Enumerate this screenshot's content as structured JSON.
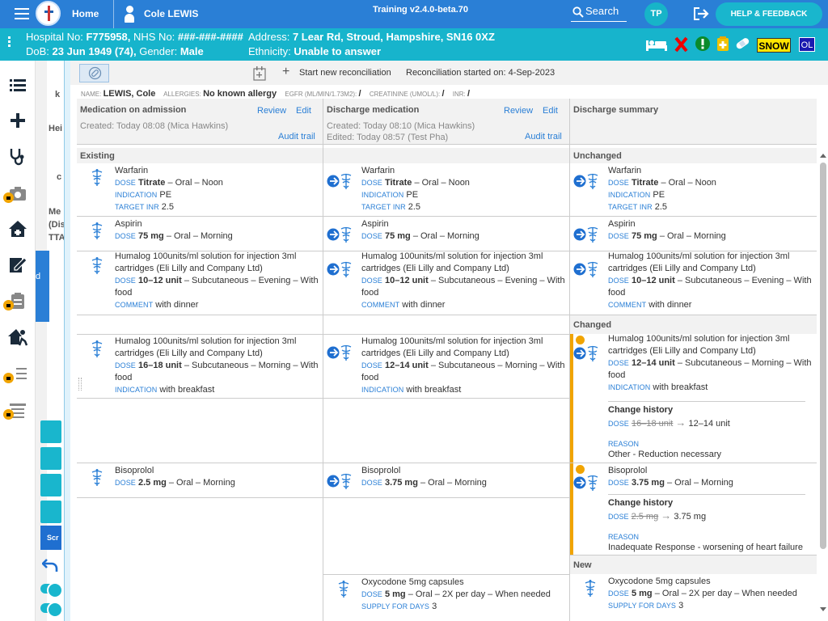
{
  "header": {
    "home_label": "Home",
    "patient_name": "Cole LEWIS",
    "training_label": "Training v2.4.0-beta.70",
    "search_label": "Search",
    "user_initials": "TP",
    "help_label": "HELP & FEEDBACK"
  },
  "patient_banner": {
    "hospital_no_label": "Hospital No:",
    "hospital_no": "F775958,",
    "nhs_label": "NHS No:",
    "nhs_no": "###-###-####",
    "address_label": "Address:",
    "address": "7 Lear Rd, Stroud, Hampshire, SN16 0XZ",
    "dob_label": "DoB:",
    "dob": "23 Jun 1949 (74),",
    "gender_label": "Gender:",
    "gender": "Male",
    "ethnicity_label": "Ethnicity:",
    "ethnicity": "Unable to answer",
    "snow_badge": "SNOW",
    "ol_badge": "OL"
  },
  "underlay": {
    "frag_k": "k",
    "frag_hei": "Hei",
    "frag_c": "c",
    "frag_me": "Me",
    "frag_dis": "(Dis",
    "frag_tta": "TTA",
    "frag_d": "d",
    "frag_scr": "Scr"
  },
  "toolbar": {
    "new_reconciliation": "Start new reconciliation",
    "reconciliation_started": "Reconciliation started on: 4-Sep-2023"
  },
  "patient_row": {
    "name_label": "NAME:",
    "name": "LEWIS, Cole",
    "allergies_label": "ALLERGIES:",
    "allergies": "No known allergy",
    "egfr_label": "EGFR (ML/MIN/1.73M2):",
    "egfr": "/",
    "creat_label": "CREATININE (UMOL/L):",
    "creat": "/",
    "inr_label": "INR:",
    "inr": "/"
  },
  "columns": {
    "admission": {
      "title": "Medication on admission",
      "review": "Review",
      "edit": "Edit",
      "created": "Created: Today 08:08 (Mica Hawkins)",
      "audit": "Audit trail"
    },
    "discharge": {
      "title": "Discharge medication",
      "review": "Review",
      "edit": "Edit",
      "created": "Created: Today 08:10 (Mica Hawkins)",
      "edited": "Edited: Today 08:57 (Test Pha)",
      "audit": "Audit trail"
    },
    "summary": {
      "title": "Discharge summary"
    }
  },
  "sections": {
    "existing": "Existing",
    "unchanged": "Unchanged",
    "changed": "Changed",
    "new": "New"
  },
  "labels": {
    "dose": "DOSE",
    "indication": "INDICATION",
    "target_inr": "TARGET INR",
    "comment": "COMMENT",
    "supply": "SUPPLY FOR DAYS",
    "change_history": "Change history",
    "reason": "REASON"
  },
  "meds": {
    "warfarin": {
      "name": "Warfarin",
      "dose_bold": "Titrate",
      "dose_rest": " – Oral – Noon",
      "indication": "PE",
      "target_inr": "2.5"
    },
    "aspirin": {
      "name": "Aspirin",
      "dose_bold": "75 mg",
      "dose_rest": " – Oral – Morning"
    },
    "humalog_name": "Humalog 100units/ml solution for injection 3ml cartridges (Eli Lilly and Company Ltd)",
    "humalog_evening": {
      "dose_bold": "10–12 unit",
      "dose_rest": " – Subcutaneous – Evening – With food",
      "comment": "with dinner"
    },
    "humalog_morning_adm": {
      "dose_bold": "16–18 unit",
      "dose_rest": " – Subcutaneous – Morning – With food",
      "indication": "with breakfast"
    },
    "humalog_morning_dis": {
      "dose_bold": "12–14 unit",
      "dose_rest": " – Subcutaneous – Morning – With food",
      "indication": "with breakfast"
    },
    "humalog_morning_sum": {
      "dose_bold": "12–14 unit",
      "dose_rest": " – Subcutaneous – Morning – With food",
      "indication": "with breakfast",
      "old": "16–18 unit",
      "new": "12–14 unit",
      "reason": "Other - Reduction necessary"
    },
    "bisoprolol_adm": {
      "name": "Bisoprolol",
      "dose_bold": "2.5 mg",
      "dose_rest": " – Oral – Morning"
    },
    "bisoprolol_dis": {
      "name": "Bisoprolol",
      "dose_bold": "3.75 mg",
      "dose_rest": " – Oral – Morning"
    },
    "bisoprolol_sum": {
      "name": "Bisoprolol",
      "dose_bold": "3.75 mg",
      "dose_rest": " – Oral – Morning",
      "old": "2.5 mg",
      "new": "3.75 mg",
      "reason": "Inadequate Response - worsening of heart failure"
    },
    "oxycodone": {
      "name": "Oxycodone 5mg capsules",
      "dose_bold": "5 mg",
      "dose_rest": " – Oral – 2X per day – When needed",
      "supply": "3"
    }
  }
}
